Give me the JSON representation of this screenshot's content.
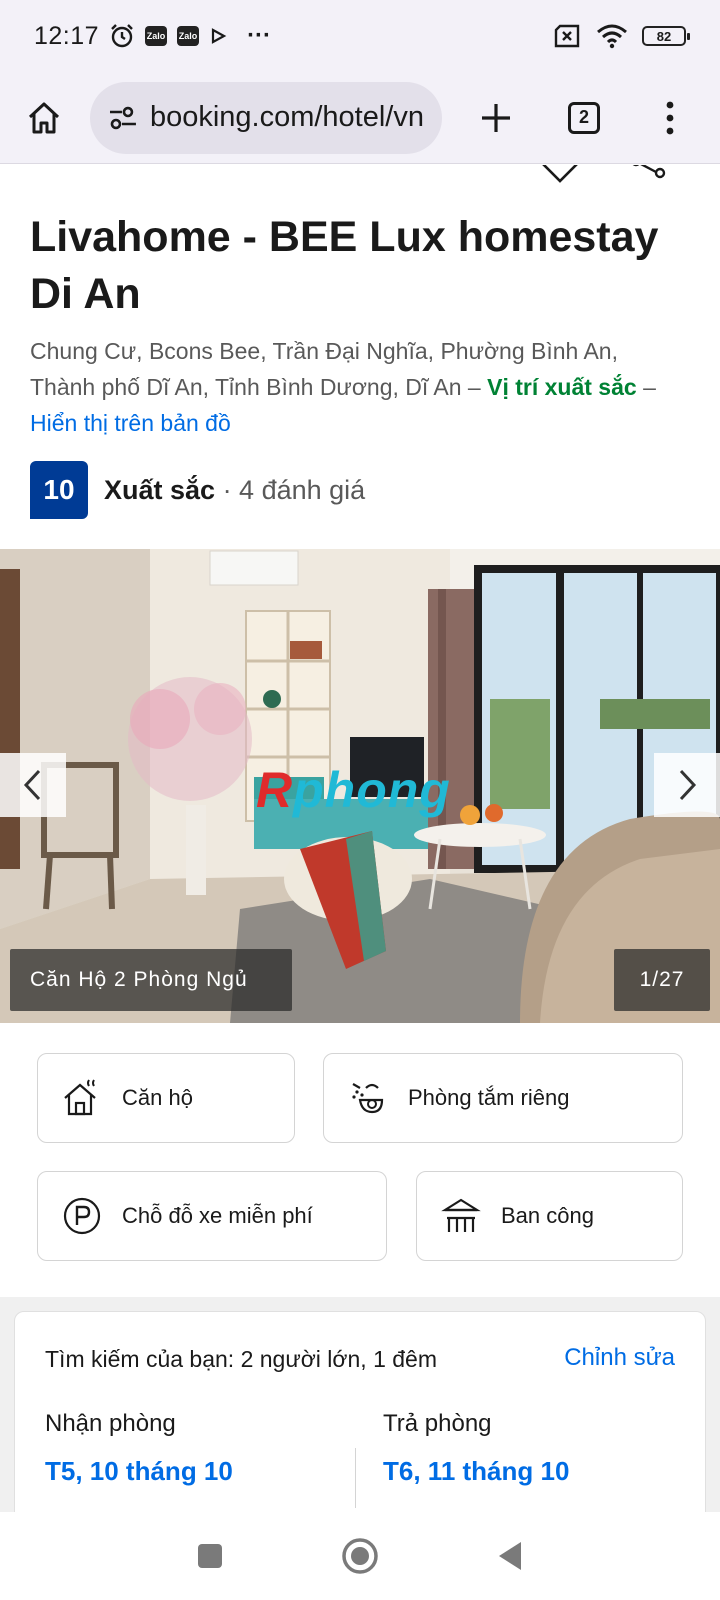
{
  "status_bar": {
    "time": "12:17",
    "zalo_1": "Zalo",
    "zalo_2": "Zalo",
    "more": "···",
    "battery": "82"
  },
  "browser": {
    "url": "booking.com/hotel/vn",
    "tab_count": "2"
  },
  "hotel": {
    "title": "Livahome - BEE Lux homestay Di An",
    "address": "Chung Cư, Bcons Bee, Trần Đại Nghĩa, Phường Bình An, Thành phố Dĩ An, Tỉnh Bình Dương, Dĩ An",
    "dash_1": " – ",
    "location_rating": "Vị trí xuất sắc",
    "dash_2": " – ",
    "map_link": "Hiển thị trên bản đồ",
    "score": "10",
    "rating_word": "Xuất sắc",
    "reviews": " · 4 đánh giá"
  },
  "photo": {
    "caption": "Căn Hộ 2 Phòng Ngủ",
    "counter": "1/27",
    "watermark_r": "R",
    "watermark_rest": "phong"
  },
  "facilities": [
    {
      "label": "Căn hộ",
      "icon": "house-icon"
    },
    {
      "label": "Phòng tắm riêng",
      "icon": "bath-icon"
    },
    {
      "label": "Chỗ đỗ xe miễn phí",
      "icon": "parking-icon"
    },
    {
      "label": "Ban công",
      "icon": "balcony-icon"
    }
  ],
  "search": {
    "summary": "Tìm kiếm của bạn: 2 người lớn, 1 đêm",
    "edit": "Chỉnh sửa",
    "checkin_label": "Nhận phòng",
    "checkin_value": "T5, 10 tháng 10",
    "checkout_label": "Trả phòng",
    "checkout_value": "T6, 11 tháng 10"
  },
  "colors": {
    "brand_blue": "#003b95",
    "link_blue": "#006ce4",
    "excellent_green": "#008234"
  }
}
